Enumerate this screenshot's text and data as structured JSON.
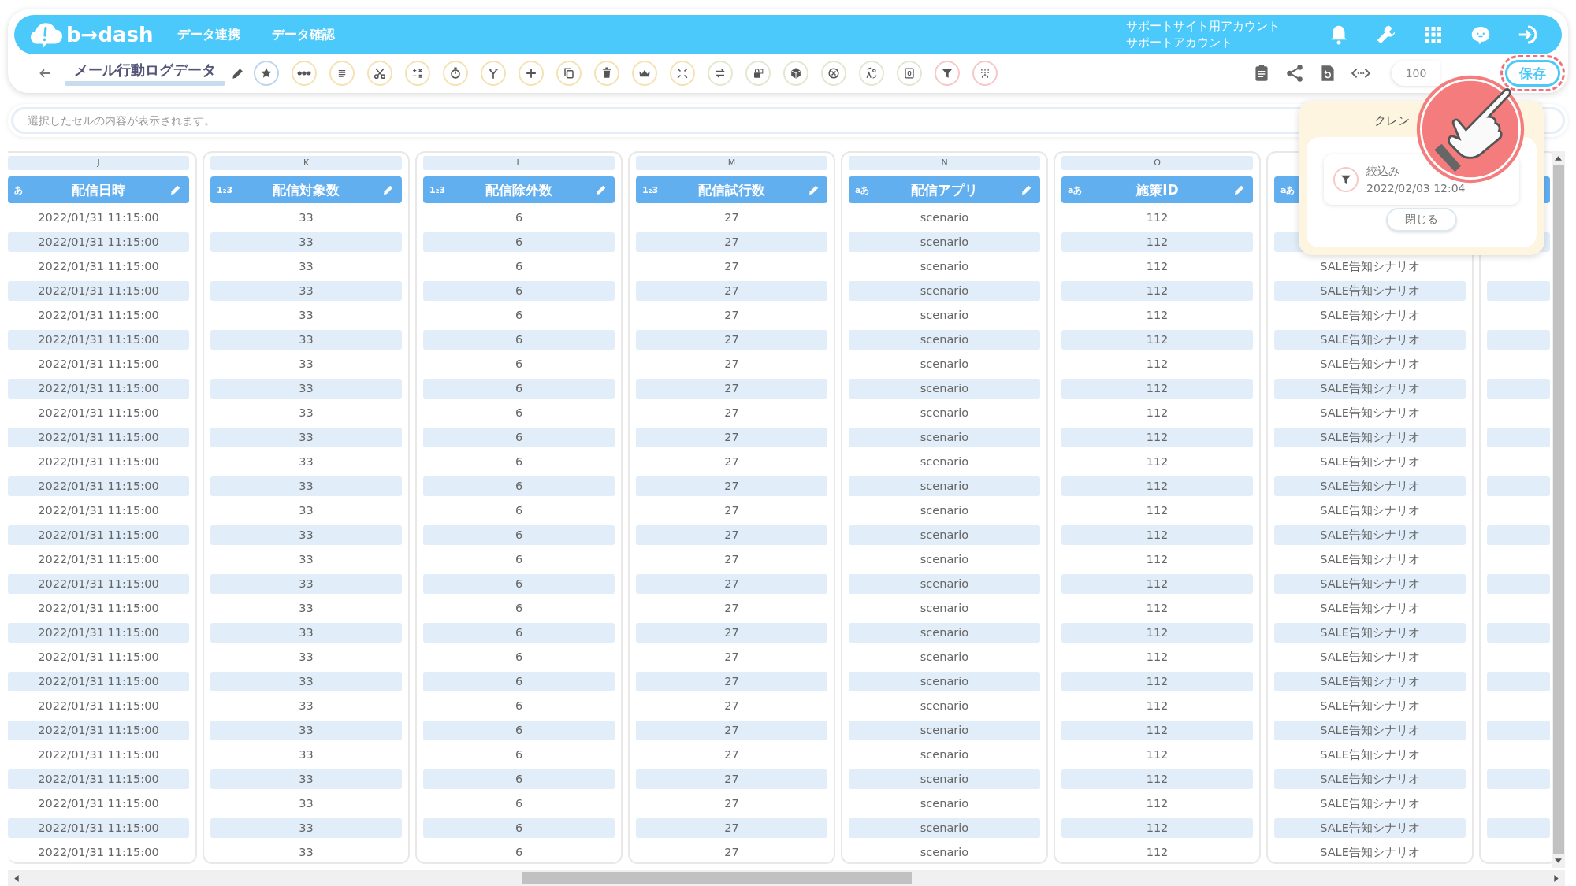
{
  "top_bar": {
    "logo": "b→dash",
    "nav": [
      "データ連携",
      "データ確認"
    ],
    "account_lines": [
      "サポートサイト用アカウント",
      "サポートアカウント"
    ]
  },
  "toolbar": {
    "title": "メール行動ログデータ",
    "tools": [
      {
        "kind": "star",
        "color": "#bcd4ec"
      },
      {
        "kind": "dots",
        "color": "#f5e2b3"
      },
      {
        "kind": "lines",
        "color": "#f5e2b3"
      },
      {
        "kind": "scissors",
        "color": "#f5e2b3"
      },
      {
        "kind": "calc",
        "color": "#f5e2b3"
      },
      {
        "kind": "timer",
        "color": "#f5e2b3"
      },
      {
        "kind": "fork",
        "color": "#f5e2b3"
      },
      {
        "kind": "plus",
        "color": "#f5e2b3"
      },
      {
        "kind": "copy",
        "color": "#f5e2b3"
      },
      {
        "kind": "trash",
        "color": "#f5e2b3"
      },
      {
        "kind": "crown",
        "color": "#f5e2b3"
      },
      {
        "kind": "compress",
        "color": "#f5e2b3"
      },
      {
        "kind": "swap",
        "color": "#e2e7cf"
      },
      {
        "kind": "lock",
        "color": "#e2e7cf"
      },
      {
        "kind": "box",
        "color": "#e2e7cf"
      },
      {
        "kind": "xcircle",
        "color": "#e2e7cf"
      },
      {
        "kind": "translate",
        "color": "#e2e7cf"
      },
      {
        "kind": "zero",
        "color": "#e2e7cf"
      },
      {
        "kind": "filter",
        "color": "#f6c8c6"
      },
      {
        "kind": "group",
        "color": "#f6c8c6"
      }
    ],
    "zoom": "100",
    "save": "保存"
  },
  "cell_field": {
    "placeholder": "選択したセルの内容が表示されます。"
  },
  "columns": [
    {
      "kind": "full",
      "letter": "J",
      "type_icon": "あ",
      "label": "配信日時"
    },
    {
      "kind": "full",
      "letter": "K",
      "type_icon": "1₂3",
      "label": "配信対象数"
    },
    {
      "kind": "full",
      "letter": "L",
      "type_icon": "1₂3",
      "label": "配信除外数"
    },
    {
      "kind": "full",
      "letter": "M",
      "type_icon": "1₂3",
      "label": "配信試行数"
    },
    {
      "kind": "full",
      "letter": "N",
      "type_icon": "aあ",
      "label": "配信アプリ"
    },
    {
      "kind": "full",
      "letter": "O",
      "type_icon": "aあ",
      "label": "施策ID"
    },
    {
      "kind": "partial",
      "type_icon": "aあ"
    },
    {
      "kind": "partial"
    }
  ],
  "rows": [
    [
      "2022/01/31 11:15:00",
      "33",
      "6",
      "27",
      "scenario",
      "112",
      null
    ],
    [
      "2022/01/31 11:15:00",
      "33",
      "6",
      "27",
      "scenario",
      "112",
      null
    ],
    [
      "2022/01/31 11:15:00",
      "33",
      "6",
      "27",
      "scenario",
      "112",
      "SALE告知シナリオ"
    ],
    [
      "2022/01/31 11:15:00",
      "33",
      "6",
      "27",
      "scenario",
      "112",
      "SALE告知シナリオ"
    ],
    [
      "2022/01/31 11:15:00",
      "33",
      "6",
      "27",
      "scenario",
      "112",
      "SALE告知シナリオ"
    ],
    [
      "2022/01/31 11:15:00",
      "33",
      "6",
      "27",
      "scenario",
      "112",
      "SALE告知シナリオ"
    ],
    [
      "2022/01/31 11:15:00",
      "33",
      "6",
      "27",
      "scenario",
      "112",
      "SALE告知シナリオ"
    ],
    [
      "2022/01/31 11:15:00",
      "33",
      "6",
      "27",
      "scenario",
      "112",
      "SALE告知シナリオ"
    ],
    [
      "2022/01/31 11:15:00",
      "33",
      "6",
      "27",
      "scenario",
      "112",
      "SALE告知シナリオ"
    ],
    [
      "2022/01/31 11:15:00",
      "33",
      "6",
      "27",
      "scenario",
      "112",
      "SALE告知シナリオ"
    ],
    [
      "2022/01/31 11:15:00",
      "33",
      "6",
      "27",
      "scenario",
      "112",
      "SALE告知シナリオ"
    ],
    [
      "2022/01/31 11:15:00",
      "33",
      "6",
      "27",
      "scenario",
      "112",
      "SALE告知シナリオ"
    ],
    [
      "2022/01/31 11:15:00",
      "33",
      "6",
      "27",
      "scenario",
      "112",
      "SALE告知シナリオ"
    ],
    [
      "2022/01/31 11:15:00",
      "33",
      "6",
      "27",
      "scenario",
      "112",
      "SALE告知シナリオ"
    ],
    [
      "2022/01/31 11:15:00",
      "33",
      "6",
      "27",
      "scenario",
      "112",
      "SALE告知シナリオ"
    ],
    [
      "2022/01/31 11:15:00",
      "33",
      "6",
      "27",
      "scenario",
      "112",
      "SALE告知シナリオ"
    ],
    [
      "2022/01/31 11:15:00",
      "33",
      "6",
      "27",
      "scenario",
      "112",
      "SALE告知シナリオ"
    ],
    [
      "2022/01/31 11:15:00",
      "33",
      "6",
      "27",
      "scenario",
      "112",
      "SALE告知シナリオ"
    ],
    [
      "2022/01/31 11:15:00",
      "33",
      "6",
      "27",
      "scenario",
      "112",
      "SALE告知シナリオ"
    ],
    [
      "2022/01/31 11:15:00",
      "33",
      "6",
      "27",
      "scenario",
      "112",
      "SALE告知シナリオ"
    ],
    [
      "2022/01/31 11:15:00",
      "33",
      "6",
      "27",
      "scenario",
      "112",
      "SALE告知シナリオ"
    ],
    [
      "2022/01/31 11:15:00",
      "33",
      "6",
      "27",
      "scenario",
      "112",
      "SALE告知シナリオ"
    ],
    [
      "2022/01/31 11:15:00",
      "33",
      "6",
      "27",
      "scenario",
      "112",
      "SALE告知シナリオ"
    ],
    [
      "2022/01/31 11:15:00",
      "33",
      "6",
      "27",
      "scenario",
      "112",
      "SALE告知シナリオ"
    ],
    [
      "2022/01/31 11:15:00",
      "33",
      "6",
      "27",
      "scenario",
      "112",
      "SALE告知シナリオ"
    ],
    [
      "2022/01/31 11:15:00",
      "33",
      "6",
      "27",
      "scenario",
      "112",
      "SALE告知シナリオ"
    ],
    [
      "2022/01/31 11:15:00",
      "33",
      "6",
      "27",
      "scenario",
      "112",
      "SALE告知シナリオ"
    ]
  ],
  "popup": {
    "title": "クレン",
    "history": [
      {
        "label": "絞込み",
        "time": "2022/02/03 12:04"
      }
    ],
    "close": "閉じる"
  }
}
